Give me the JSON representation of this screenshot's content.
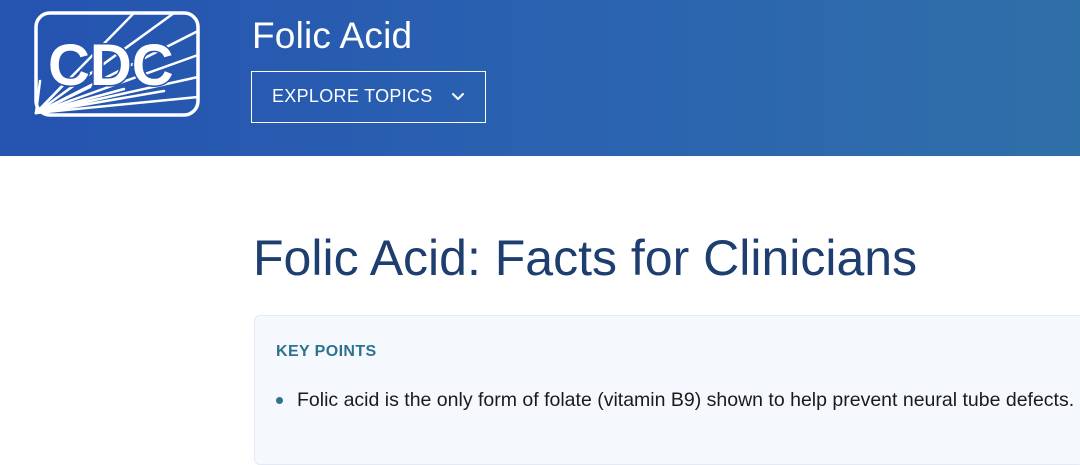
{
  "header": {
    "logo_text": "CDC",
    "site_title": "Folic Acid",
    "explore_button_label": "EXPLORE TOPICS",
    "explore_button_icon": "chevron-down-icon"
  },
  "main": {
    "page_title": "Folic Acid: Facts for Clinicians",
    "key_points": {
      "heading": "KEY POINTS",
      "items": [
        "Folic acid is the only form of folate (vitamin B9) shown to help prevent neural tube defects."
      ]
    }
  },
  "colors": {
    "header_bg_start": "#2453b0",
    "header_bg_end": "#2f6fa8",
    "title_color": "#1d3e6e",
    "accent_teal": "#2f7290",
    "callout_bg": "#f5f8fc"
  }
}
